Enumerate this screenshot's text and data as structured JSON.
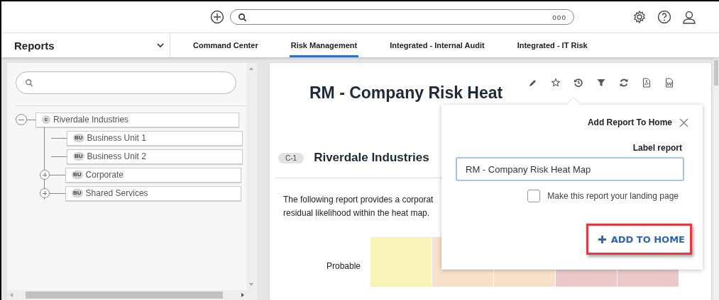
{
  "top_bar": {
    "more": "ooo"
  },
  "module": {
    "label": "Reports"
  },
  "tabs": [
    {
      "label": "Command Center",
      "selected": false
    },
    {
      "label": "Risk Management",
      "selected": true
    },
    {
      "label": "Integrated - Internal Audit",
      "selected": false
    },
    {
      "label": "Integrated - IT Risk",
      "selected": false
    }
  ],
  "tree": [
    {
      "label": "Riverdale Industries",
      "badge": "c",
      "expanded": true,
      "children": [
        {
          "label": "Business Unit 1",
          "badge": "BU"
        },
        {
          "label": "Business Unit 2",
          "badge": "BU"
        },
        {
          "label": "Corporate",
          "badge": "BU",
          "expanded": false
        },
        {
          "label": "Shared Services",
          "badge": "BU",
          "expanded": false
        }
      ]
    }
  ],
  "report": {
    "title": "RM - Company Risk Heat",
    "section": {
      "badge": "C-1",
      "title": "Riverdale Industries"
    },
    "description": [
      "The following report provides a corporat",
      "residual likelihood within the heat map."
    ],
    "heat_map": {
      "rows": [
        {
          "label": "Probable",
          "cells": [
            {
              "color": "#f8f3b9"
            },
            {
              "color": "#f9e1c9"
            },
            {
              "color": "#f9e1c9"
            },
            {
              "color": "#ecc8cb"
            },
            {
              "color": "#ecc8cb"
            }
          ]
        }
      ]
    }
  },
  "popover": {
    "title": "Add Report To Home",
    "field_label": "Label report",
    "value": "RM - Company Risk Heat Map",
    "landing_page": {
      "label": "Make this report your landing page",
      "checked": false
    },
    "button": {
      "label": "ADD TO HOME",
      "highlighted": true
    }
  }
}
